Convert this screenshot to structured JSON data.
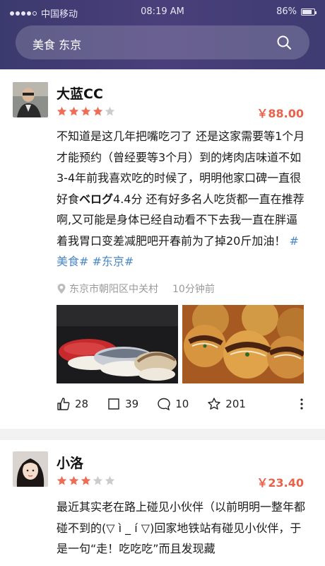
{
  "status_bar": {
    "carrier": "中国移动",
    "time": "08:19 AM",
    "battery": "86%"
  },
  "search": {
    "query": "美食 东京",
    "icon": "search-icon"
  },
  "posts": [
    {
      "username": "大蓝CC",
      "rating": 4,
      "rating_max": 5,
      "price": "￥88.00",
      "text": "不知道是这几年把嘴吃刁了 还是这家需要等1个月才能预约（曾经要等3个月）到的烤肉店味道不如3-4年前我喜欢吃的时候了，明明他家口碑一直很好食",
      "text_bold": "ベログ",
      "text_after": "4.4分 还有好多名人吃货都一直在推荐啊,又可能是身体已经自动看不下去我一直在胖逼着我胃口变差减肥吧开春前为了掉20斤加油！",
      "tags": [
        "#美食#",
        "#东京#"
      ],
      "location": "东京市朝阳区中关村",
      "time_ago": "10分钟前",
      "likes": "28",
      "shares": "39",
      "comments": "10",
      "favorites": "201"
    },
    {
      "username": "小洛",
      "rating": 3,
      "rating_max": 5,
      "price": "￥23.40",
      "text": "最近其实老在路上碰见小伙伴（以前明明一整年都碰不到的(▽ ì _ í ▽)回家地铁站有碰见小伙伴，于是一句“走！吃吃吃”而且发现藏"
    }
  ],
  "colors": {
    "header": "#413d74",
    "price": "#e8624c",
    "star_on": "#ef6d57",
    "star_off": "#cccccc",
    "tag": "#4a88c7"
  }
}
